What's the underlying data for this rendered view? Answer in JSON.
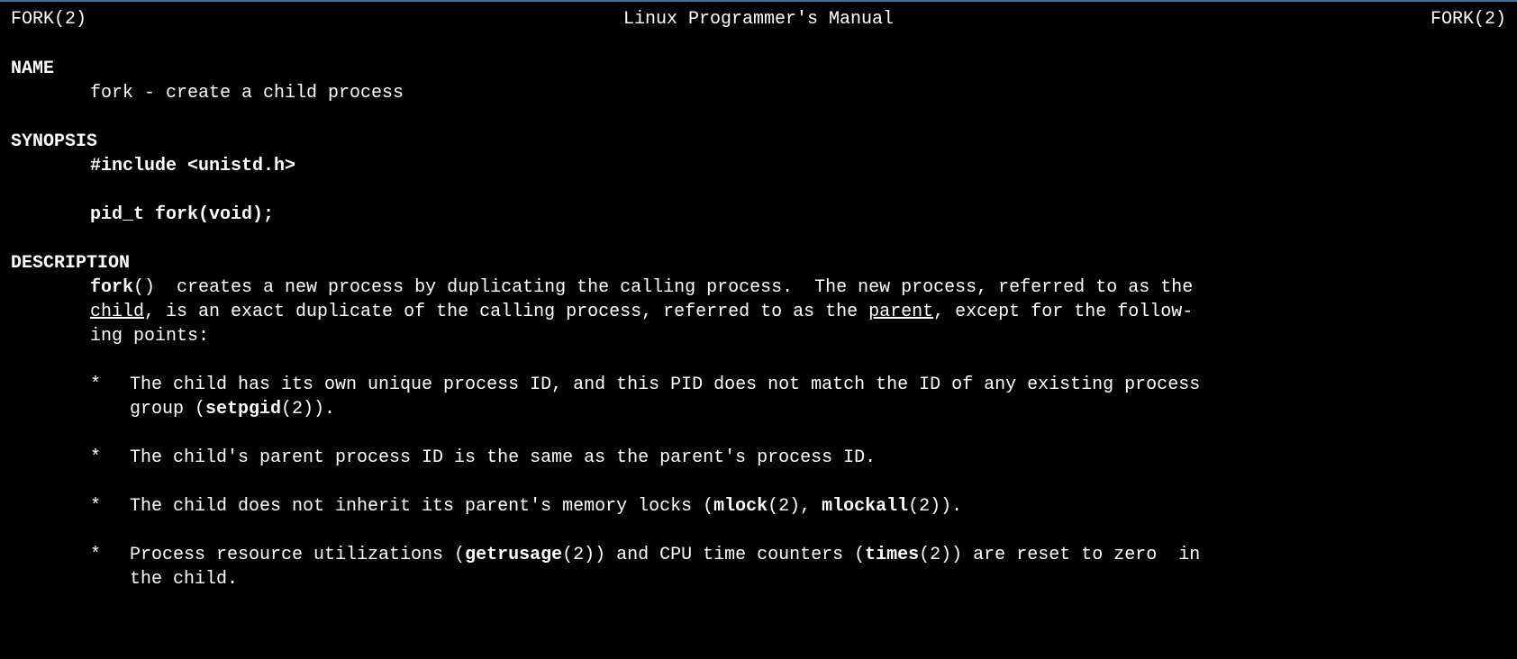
{
  "header": {
    "left": "FORK(2)",
    "center": "Linux Programmer's Manual",
    "right": "FORK(2)"
  },
  "sections": {
    "name": {
      "heading": "NAME",
      "content": "fork - create a child process"
    },
    "synopsis": {
      "heading": "SYNOPSIS",
      "include": "#include <unistd.h>",
      "signature": "pid_t fork(void);"
    },
    "description": {
      "heading": "DESCRIPTION",
      "intro": {
        "fn": "fork",
        "text1": "()  creates a new process by duplicating the calling process.  The new process, referred to as the ",
        "child": "child",
        "text2": ", is an exact duplicate of the calling process, referred to as the ",
        "parent": "parent",
        "text3": ", except for the follow-",
        "text4": "ing points:"
      },
      "bullets": [
        {
          "line1a": "The child has its own unique process ID, and this PID does not match the ID of any existing process",
          "line2a": "group (",
          "bold1": "setpgid",
          "line2b": "(2))."
        },
        {
          "line1a": "The child's parent process ID is the same as the parent's process ID."
        },
        {
          "line1a": "The child does not inherit its parent's memory locks (",
          "bold1": "mlock",
          "line1b": "(2), ",
          "bold2": "mlockall",
          "line1c": "(2))."
        },
        {
          "line1a": "Process resource utilizations (",
          "bold1": "getrusage",
          "line1b": "(2)) and CPU time counters (",
          "bold2": "times",
          "line1c": "(2)) are reset to zero  in",
          "line2a": "the child."
        }
      ]
    }
  },
  "bullet_marker": "*"
}
